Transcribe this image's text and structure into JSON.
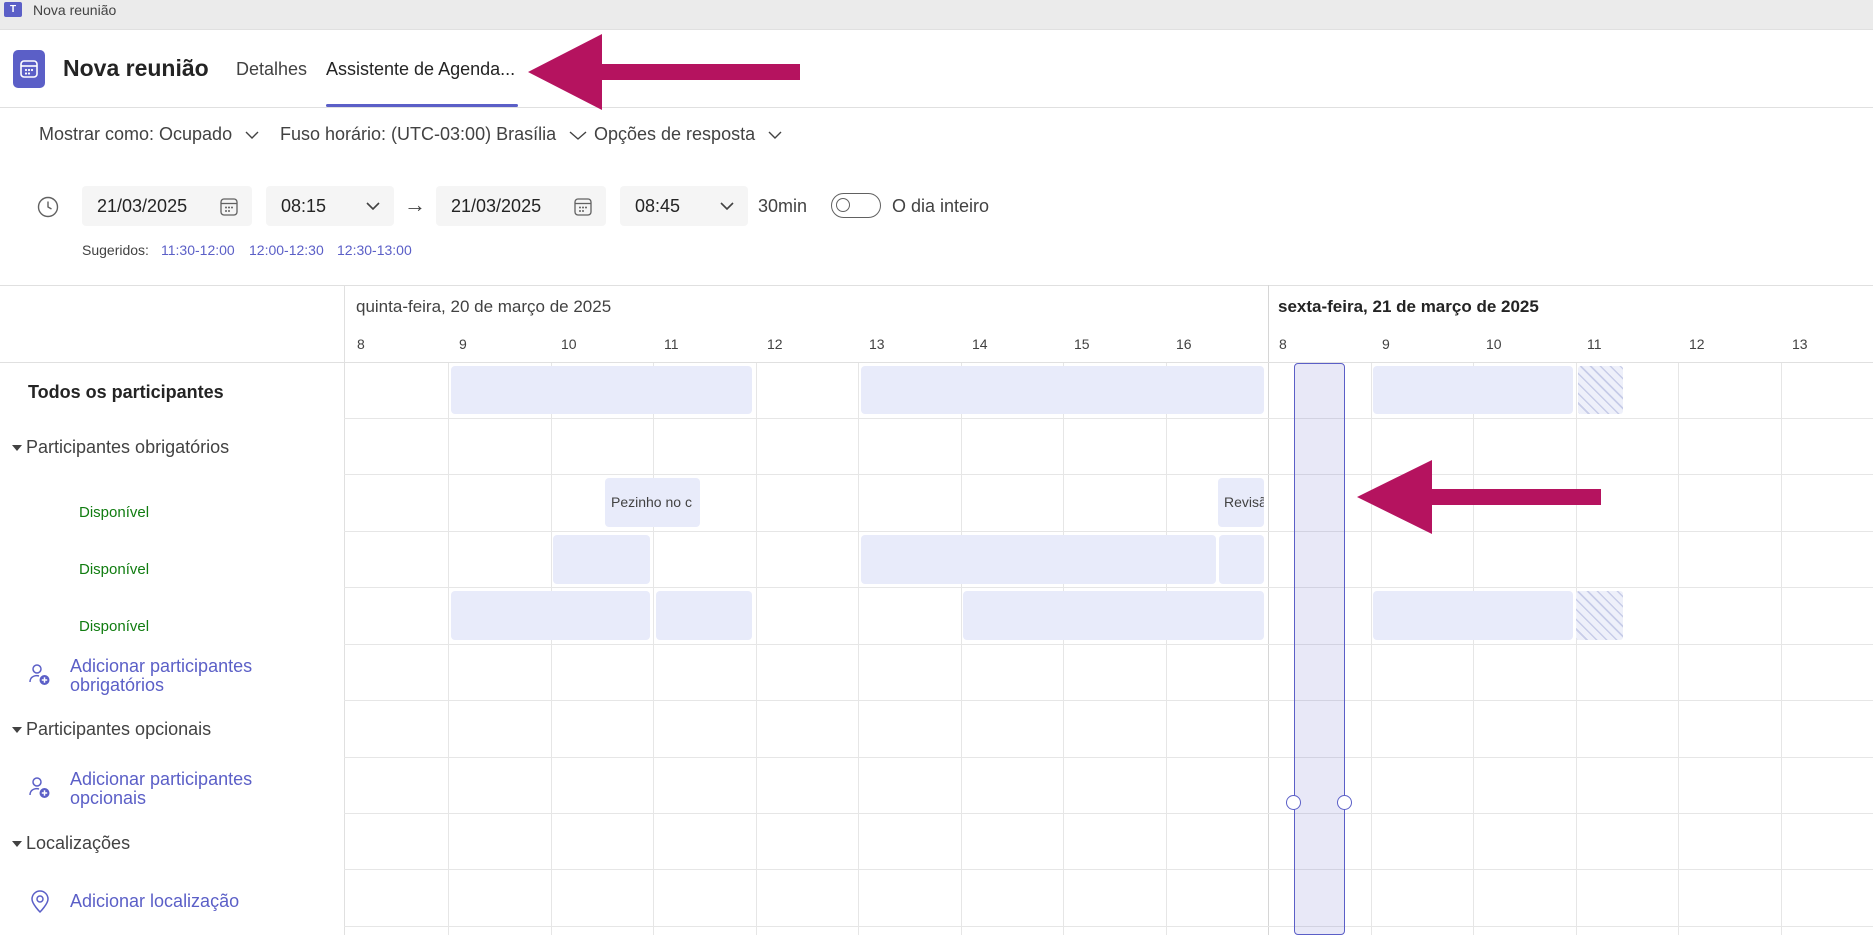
{
  "window": {
    "title": "Nova reunião"
  },
  "header": {
    "title": "Nova reunião",
    "tabs": [
      {
        "label": "Detalhes"
      },
      {
        "label": "Assistente de Agenda..."
      }
    ]
  },
  "options": {
    "show_as": "Mostrar como: Ocupado",
    "timezone": "Fuso horário: (UTC-03:00) Brasília",
    "response": "Opções de resposta"
  },
  "time": {
    "start_date": "21/03/2025",
    "start_time": "08:15",
    "end_date": "21/03/2025",
    "end_time": "08:45",
    "duration": "30min",
    "all_day_label": "O dia inteiro",
    "all_day_on": false,
    "suggested_label": "Sugeridos:",
    "suggestions": [
      "11:30-12:00",
      "12:00-12:30",
      "12:30-13:00"
    ]
  },
  "grid": {
    "days": [
      {
        "label": "quinta-feira, 20 de março de 2025",
        "hours": [
          "8",
          "9",
          "10",
          "11",
          "12",
          "13",
          "14",
          "15",
          "16"
        ]
      },
      {
        "label": "sexta-feira, 21 de março de 2025",
        "hours": [
          "8",
          "9",
          "10",
          "11",
          "12",
          "13"
        ]
      }
    ],
    "events": {
      "pezinho": "Pezinho no c",
      "revisao": "Revisã"
    }
  },
  "left": {
    "all_participants": "Todos os participantes",
    "required_section": "Participantes obrigatórios",
    "statuses": [
      "Disponível",
      "Disponível",
      "Disponível"
    ],
    "add_required_line1": "Adicionar participantes",
    "add_required_line2": "obrigatórios",
    "optional_section": "Participantes opcionais",
    "add_optional_line1": "Adicionar participantes",
    "add_optional_line2": "opcionais",
    "locations_section": "Localizações",
    "add_location": "Adicionar localização"
  },
  "colors": {
    "accent": "#5b5fc7",
    "busy": "#e8ebfa",
    "available": "#107c10",
    "annotation_arrow": "#b5135f"
  }
}
